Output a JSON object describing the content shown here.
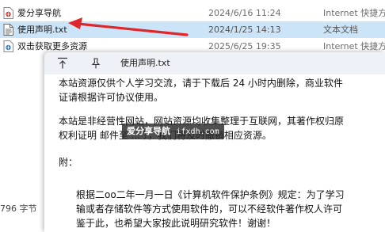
{
  "explorer": {
    "files": [
      {
        "name": "爱分享导航",
        "date": "2024/6/16 11:24",
        "type": "Internet 快捷方式",
        "icon": "internet-shortcut-icon",
        "selected": false
      },
      {
        "name": "使用声明.txt",
        "date": "2024/1/25 14:13",
        "type": "文本文档",
        "icon": "text-file-icon",
        "selected": true
      },
      {
        "name": "双击获取更多资源",
        "date": "2025/6/25 19:35",
        "type": "Internet 快捷方式",
        "icon": "internet-shortcut-icon",
        "selected": false
      }
    ],
    "status_size": "796 字节"
  },
  "notepad": {
    "tab_title": "使用声明.txt",
    "lines": [
      "本站资源仅供个人学习交流，请于下载后 24 小时内删除，商业软件",
      "证请根据许可协议使用。",
      "本站是非经营性网站，网站资源均收集整理于互联网，其著作权归原",
      "权利证明 邮件至 ... ），我们将及时撤销相应资源。",
      "附：",
      "根据二oo二年一月一日《计算机软件保护条例》规定：为了学习",
      "输或者存储软件等方式使用软件的，可以不经软件著作权人许可",
      "鉴于此，也希望大家按此说明研究软件！谢谢！"
    ]
  },
  "watermark": {
    "title": "爱分享导航",
    "url": "ifxdh.com"
  },
  "colors": {
    "selection": "#cce4f7",
    "annotation_arrow": "#e0252b",
    "titlebar": "#eef1f5"
  }
}
